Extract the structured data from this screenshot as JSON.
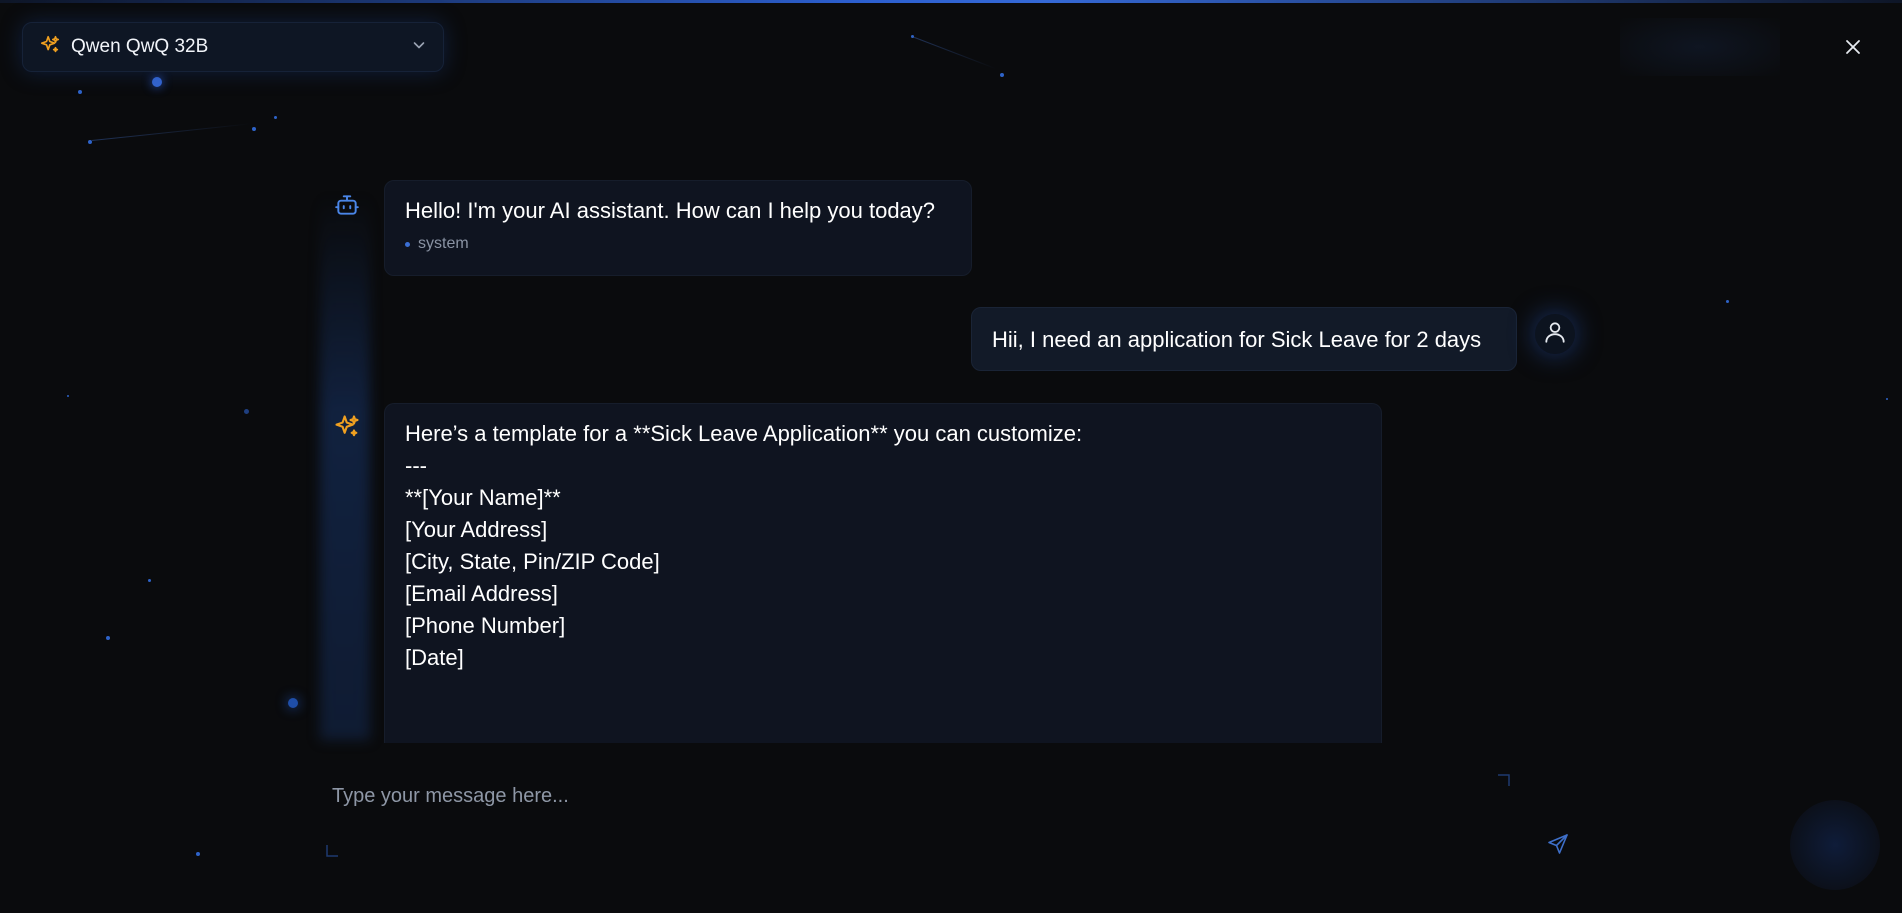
{
  "header": {
    "model_name": "Qwen QwQ 32B",
    "model_icon": "sparkles-icon",
    "dropdown_icon": "chevron-down-icon",
    "close_icon": "close-icon"
  },
  "messages": [
    {
      "role_label": "system",
      "avatar_icon": "bot-icon",
      "text": "Hello! I'm your AI assistant. How can I help you today?"
    },
    {
      "avatar_icon": "user-icon",
      "text": "Hii, I need an application for Sick Leave for 2 days"
    },
    {
      "avatar_icon": "sparkles-icon",
      "lines": [
        "Here’s a template for a **Sick Leave Application** you can customize:",
        "",
        "---",
        "",
        "**[Your Name]**",
        "[Your Address]",
        "[City, State, Pin/ZIP Code]",
        "[Email Address]",
        "[Phone Number]",
        "[Date]"
      ]
    }
  ],
  "composer": {
    "placeholder": "Type your message here...",
    "send_icon": "send-icon"
  },
  "colors": {
    "background": "#0a0b0d",
    "accent_orange": "#f0a020",
    "accent_blue": "#3b6fd4",
    "bubble": "#0f1420"
  }
}
